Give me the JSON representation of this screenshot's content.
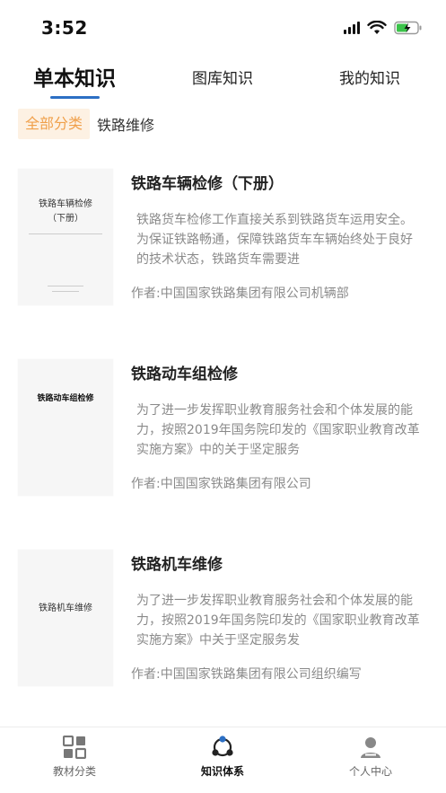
{
  "status_bar": {
    "time": "3:52"
  },
  "top_tabs": [
    {
      "label": "单本知识",
      "active": true
    },
    {
      "label": "图库知识",
      "active": false
    },
    {
      "label": "我的知识",
      "active": false
    }
  ],
  "filter": {
    "chip_label": "全部分类",
    "path": "铁路维修"
  },
  "items": [
    {
      "title": "铁路车辆检修（下册）",
      "description": "铁路货车检修工作直接关系到铁路货车运用安全。为保证铁路畅通，保障铁路货车车辆始终处于良好的技术状态，铁路货车需要进",
      "author": "作者:中国国家铁路集团有限公司机辆部",
      "cover_line1": "铁路车辆检修",
      "cover_line2": "（下册）"
    },
    {
      "title": "铁路动车组检修",
      "description": "为了进一步发挥职业教育服务社会和个体发展的能力，按照2019年国务院印发的《国家职业教育改革实施方案》中的关于坚定服务",
      "author": "作者:中国国家铁路集团有限公司",
      "cover_line1": "铁路动车组检修"
    },
    {
      "title": "铁路机车维修",
      "description": "为了进一步发挥职业教育服务社会和个体发展的能力，按照2019年国务院印发的《国家职业教育改革实施方案》中关于坚定服务发",
      "author": "作者:中国国家铁路集团有限公司组织编写",
      "cover_line1": "铁路机车维修"
    }
  ],
  "bottom_nav": [
    {
      "label": "教材分类",
      "icon": "grid-icon",
      "active": false
    },
    {
      "label": "知识体系",
      "icon": "network-icon",
      "active": true
    },
    {
      "label": "个人中心",
      "icon": "user-icon",
      "active": false
    }
  ],
  "colors": {
    "accent": "#2c6fc4",
    "chip_bg": "#fdf1e3",
    "chip_text": "#f0a04b"
  }
}
